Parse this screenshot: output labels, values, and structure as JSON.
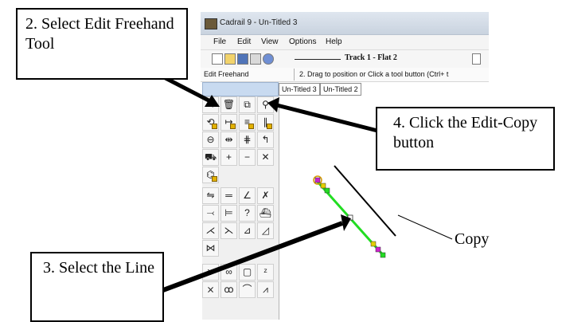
{
  "window": {
    "title": "Cadrail 9 - Un-Titled 3"
  },
  "menu": [
    "File",
    "Edit",
    "View",
    "Options",
    "Help"
  ],
  "toolbar": {
    "track_label": "Track 1 - Flat 2"
  },
  "status": {
    "mode": "Edit Freehand",
    "hint": "2. Drag to position or Click a tool button (Ctrl+ t"
  },
  "tabs": [
    "Un-Titled 3",
    "Un-Titled 2"
  ],
  "callouts": {
    "step2": "2. Select Edit Freehand Tool",
    "step3": "3. Select the Line",
    "step4": "4. Click the Edit-Copy button",
    "copy": "Copy"
  },
  "icons": [
    "app-icon",
    "new-file-icon",
    "open-folder-icon",
    "save-disk-icon",
    "print-icon",
    "help-icon",
    "grid-icon",
    "pointer-icon",
    "trash-icon",
    "copy-icon",
    "shape-icon"
  ],
  "colors": {
    "selected_line": "#22dd22",
    "handle_magenta": "#cc22cc",
    "handle_yellow": "#e2d000",
    "tab_spacer": "#c8daf0"
  }
}
